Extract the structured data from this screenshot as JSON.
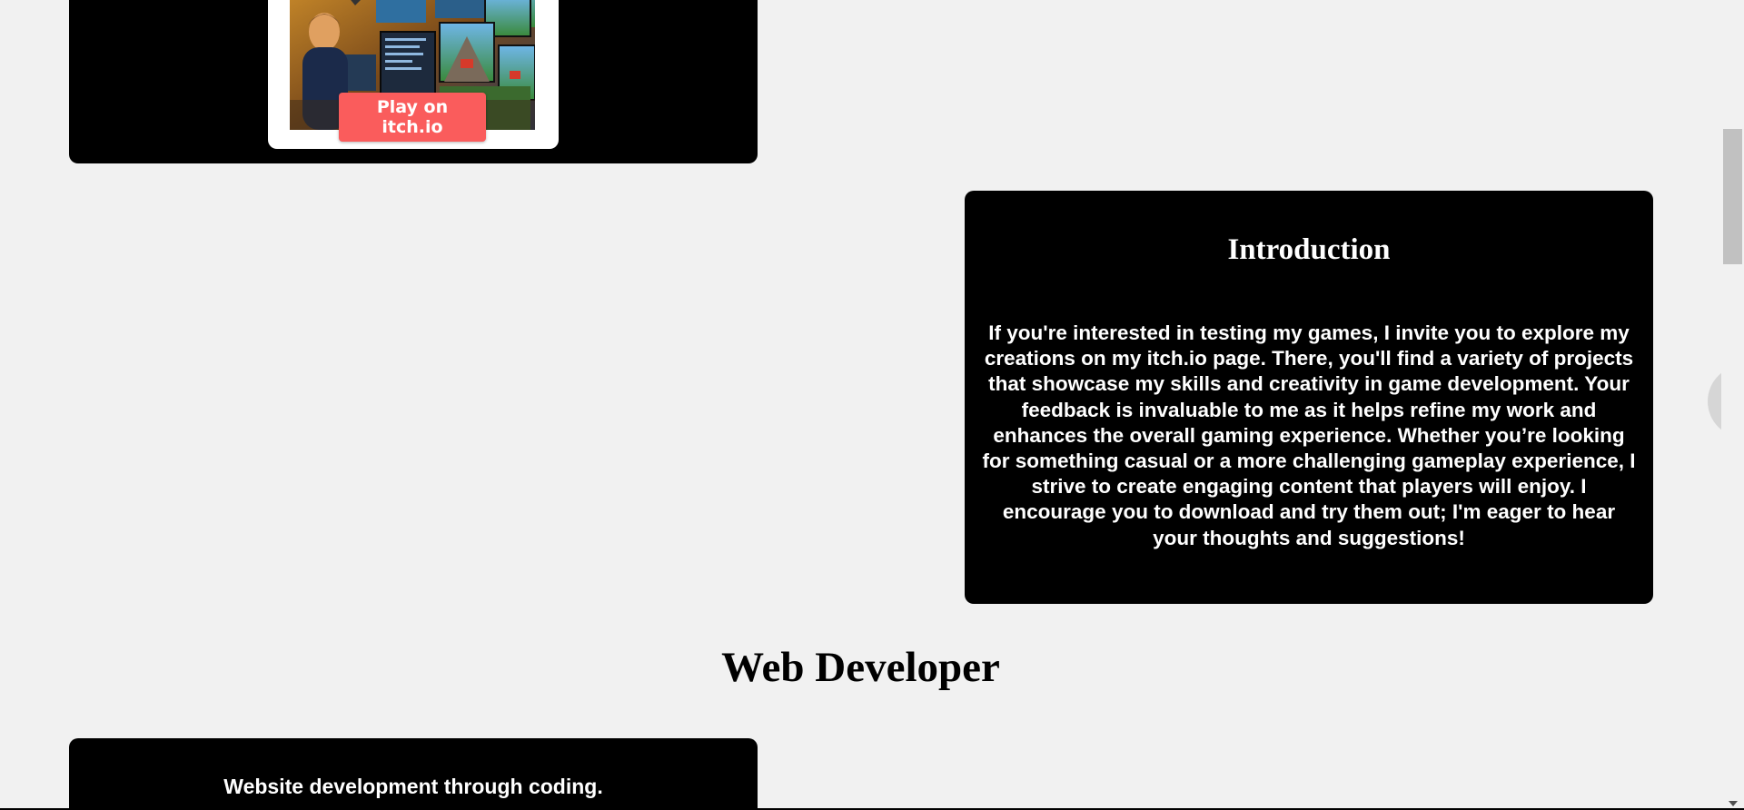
{
  "game_card": {
    "play_button_label": "Play on itch.io"
  },
  "intro": {
    "title": "Introduction",
    "body": "If you're interested in testing my games, I invite you to explore my creations on my itch.io page. There, you'll find a variety of projects that showcase my skills and creativity in game development. Your feedback is invaluable to me as it helps refine my work and enhances the overall gaming experience. Whether you’re looking for something casual or a more challenging gameplay experience, I strive to create engaging content that players will enjoy. I encourage you to download and try them out; I'm eager to hear your thoughts and suggestions!"
  },
  "web_section": {
    "heading": "Web Developer",
    "card_text": "Website development through coding."
  },
  "colors": {
    "page_background": "#f1f1f1",
    "card_background": "#000000",
    "play_button": "#fa5c5c"
  }
}
